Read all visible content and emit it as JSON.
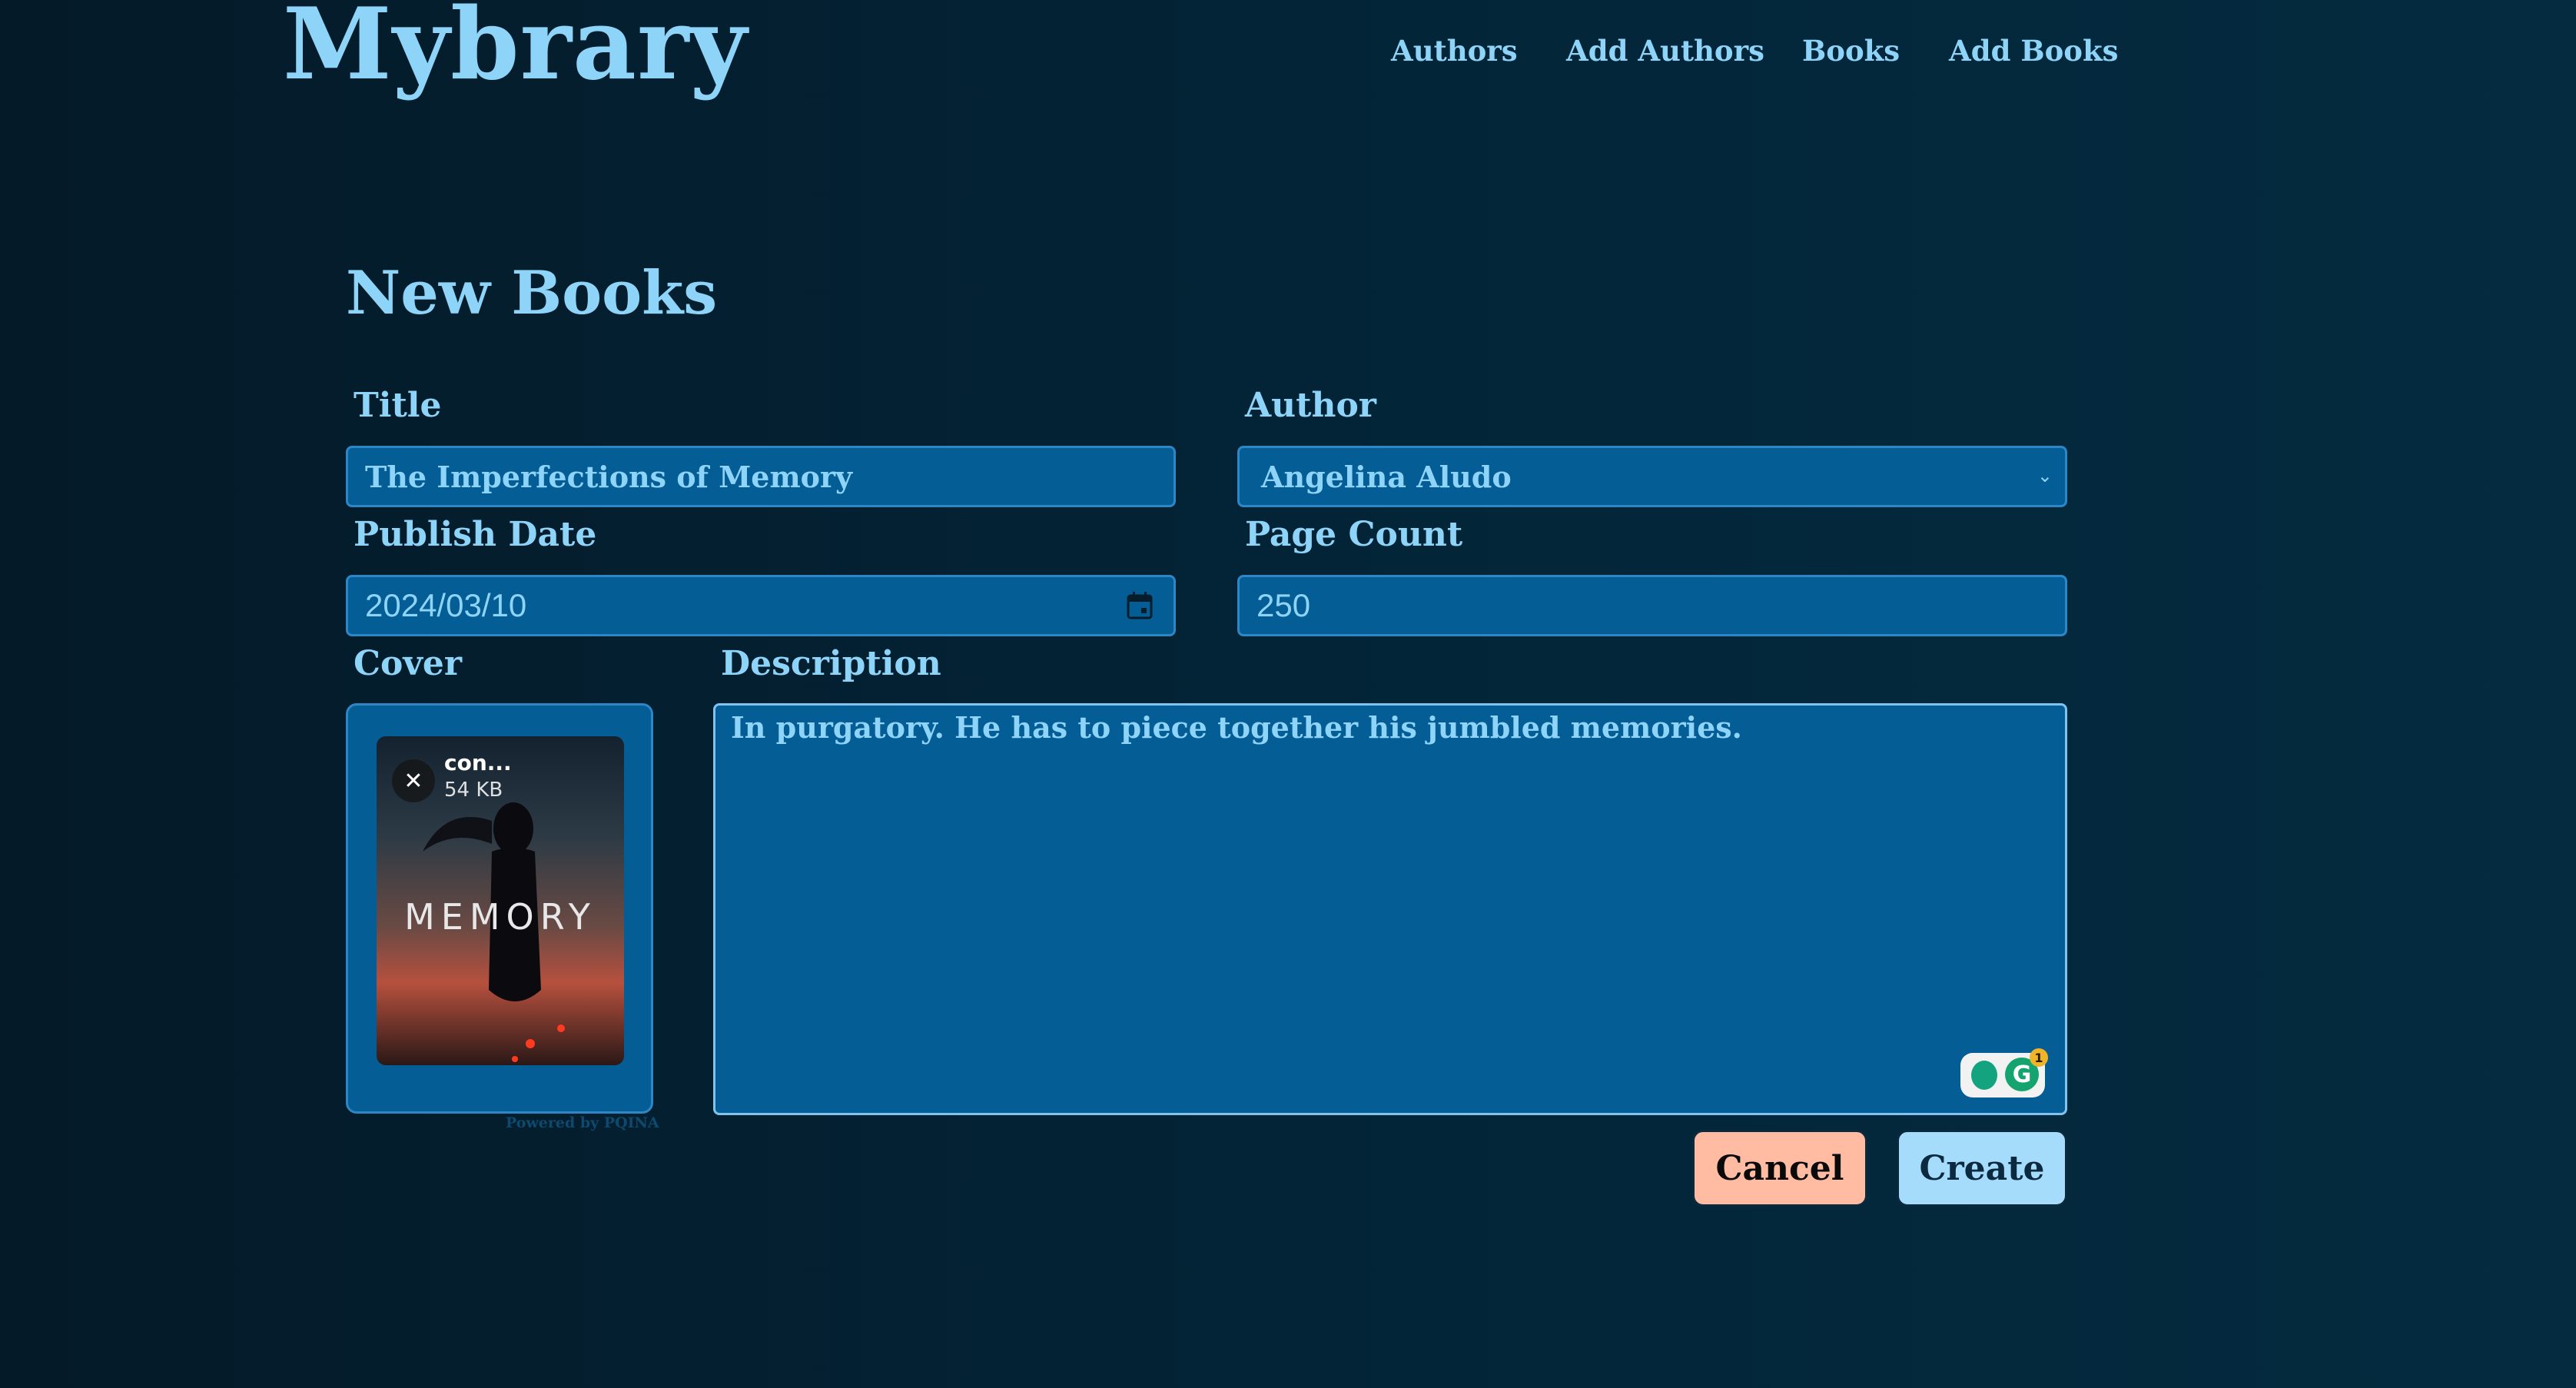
{
  "header": {
    "logo": "Mybrary",
    "nav": [
      "Authors",
      "Add Authors",
      "Books",
      "Add Books"
    ]
  },
  "form": {
    "heading": "New Books",
    "title": {
      "label": "Title",
      "value": "The Imperfections of Memory"
    },
    "author": {
      "label": "Author",
      "value": "Angelina Aludo"
    },
    "publish_date": {
      "label": "Publish Date",
      "value": "2024/03/10"
    },
    "page_count": {
      "label": "Page Count",
      "value": "250"
    },
    "cover": {
      "label": "Cover",
      "file_name": "con...",
      "file_size": "54 KB",
      "cover_word": "MEMORY",
      "powered_by": "Powered by PQINA"
    },
    "description": {
      "label": "Description",
      "value": "In purgatory. He has to piece together his jumbled memories."
    },
    "grammarly_badge": "1",
    "cancel_label": "Cancel",
    "create_label": "Create"
  },
  "colors": {
    "accent_text": "#8ed4f8",
    "field_bg": "#045d94",
    "cancel_bg": "#ffbca3",
    "create_bg": "#a6dcfb"
  }
}
